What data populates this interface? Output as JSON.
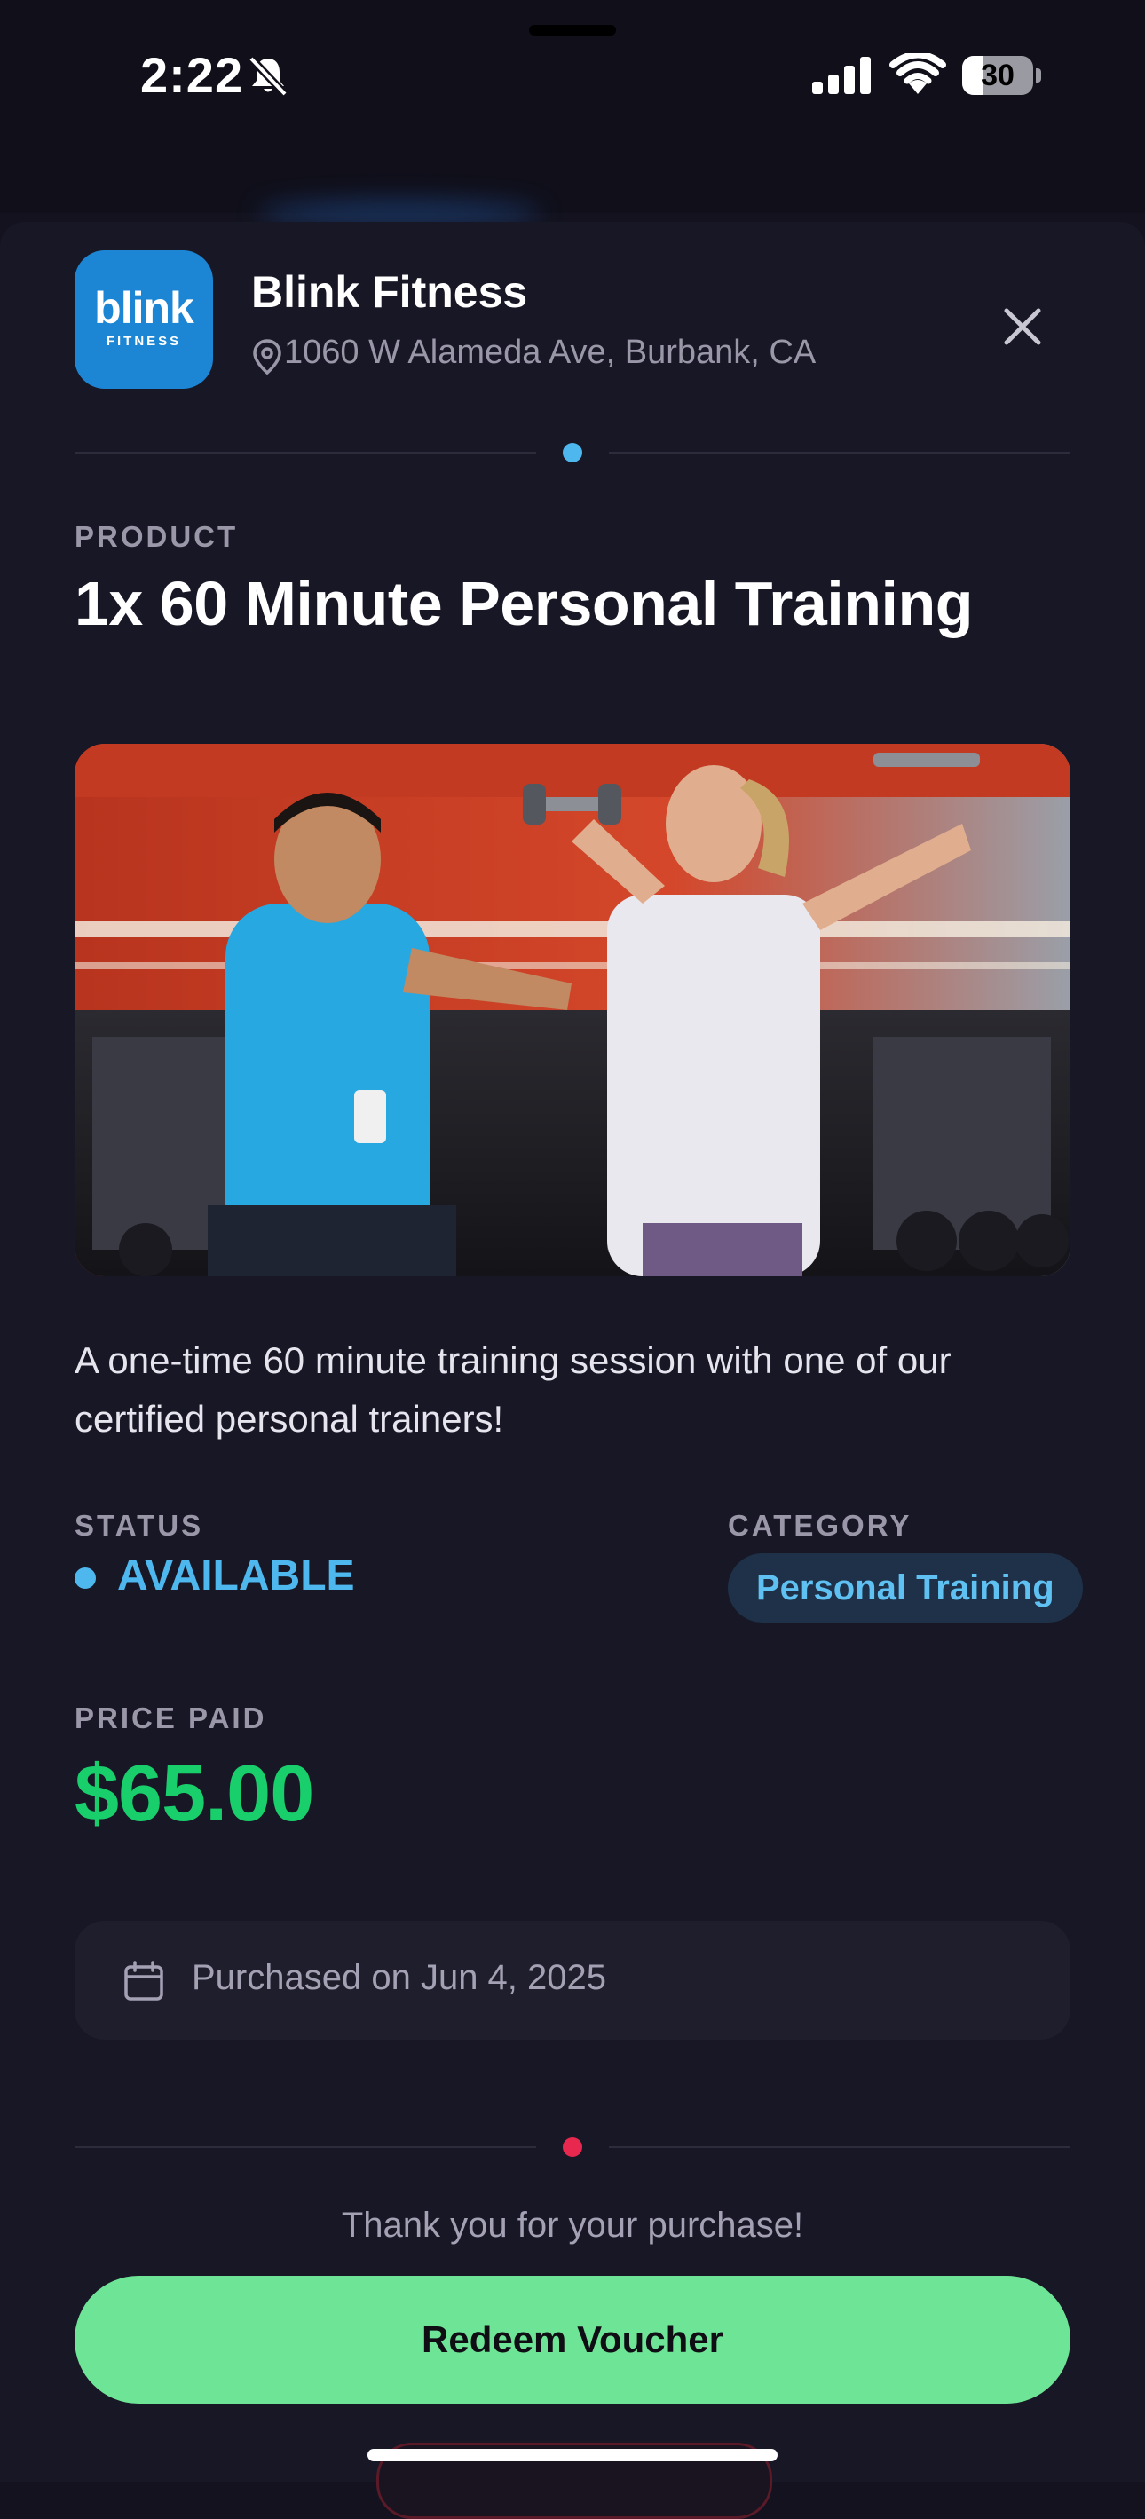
{
  "status_bar": {
    "time": "2:22",
    "battery_level": "30",
    "icons": [
      "bell-slash-icon",
      "cellular-signal-icon",
      "wifi-icon",
      "battery-icon"
    ]
  },
  "merchant": {
    "logo_text": "blink",
    "logo_subtext": "FITNESS",
    "name": "Blink Fitness",
    "address": "1060 W Alameda Ave, Burbank, CA"
  },
  "product": {
    "label": "PRODUCT",
    "title": "1x 60 Minute Personal Training",
    "image_alt": "Personal trainer coaching a woman lifting dumbbells in a gym",
    "description": "A one-time 60 minute training session with one of our certified personal trainers!"
  },
  "status": {
    "label": "STATUS",
    "value": "AVAILABLE"
  },
  "category": {
    "label": "CATEGORY",
    "value": "Personal Training"
  },
  "price": {
    "label": "PRICE PAID",
    "value": "$65.00"
  },
  "purchase": {
    "text": "Purchased on Jun 4, 2025"
  },
  "footer": {
    "thanks": "Thank you for your purchase!",
    "redeem_label": "Redeem Voucher"
  },
  "colors": {
    "background": "#13121e",
    "sheet": "#181726",
    "accent_blue": "#4db7ee",
    "price_green": "#19cf6c",
    "button_green": "#6ee596",
    "divider_red_dot": "#e8284f",
    "logo_blue": "#1c86d4"
  }
}
